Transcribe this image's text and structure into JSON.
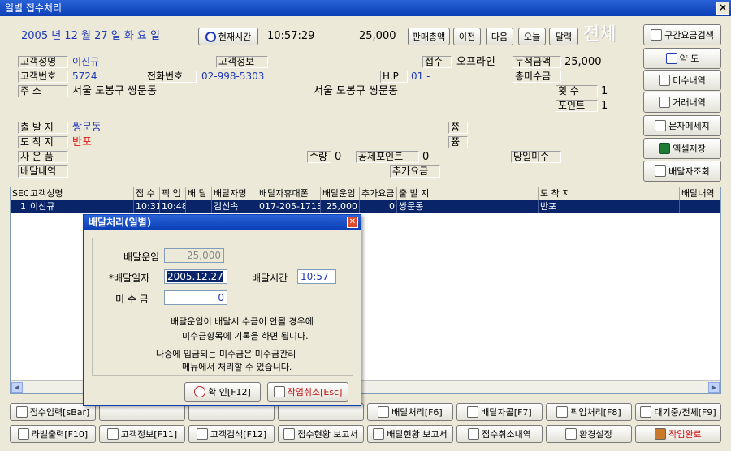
{
  "window": {
    "title": "일별 접수처리",
    "close": "×"
  },
  "header": {
    "date": "2005 년   12 월  27 일  화 요 일",
    "now_button": "현재시간",
    "time": "10:57:29",
    "amount": "25,000",
    "nav": [
      "판매총액",
      "이전",
      "다음",
      "오늘",
      "달력"
    ],
    "all_label": "전체"
  },
  "form": {
    "name_label": "고객성명",
    "name": "이신규",
    "info_label": "고객정보",
    "receipt_label": "접수",
    "receipt": "오프라인",
    "total_label": "누적금액",
    "total": "25,000",
    "custno_label": "고객번호",
    "custno": "5724",
    "phone_label": "전화번호",
    "phone": "02-998-5303",
    "hp_label": "H.P",
    "hp": "01 -",
    "unpaid_label": "총미수금",
    "addr_label": "주      소",
    "addr": "서울 도봉구 쌍문동",
    "addr2": "서울 도봉구 쌍문동",
    "count_label": "횟   수",
    "count": "1",
    "point_label": "포인트",
    "point": "1",
    "origin_label": "출 발 지",
    "origin": "쌍문동",
    "dest_label": "도 착 지",
    "dest": "반포",
    "gift_label": "사 은 품",
    "qty_label": "수량",
    "qty": "0",
    "deduct_label": "공제포인트",
    "deduct": "0",
    "today_unpaid_label": "당일미수",
    "delivery_label": "배달내역",
    "extra_label": "추가요금",
    "mark1": "쯈",
    "mark2": "쯈"
  },
  "side_buttons": [
    "구간요금검색",
    "약 도",
    "미수내역",
    "거래내역",
    "문자메세지",
    "엑셀저장",
    "배달자조회"
  ],
  "grid": {
    "columns": [
      "SEQ",
      "고객성명",
      "접 수",
      "픽 업",
      "배 달",
      "배달자명",
      "배달자휴대폰",
      "배달운임",
      "추가요금",
      "출 발 지",
      "도 착 지",
      "배달내역"
    ],
    "row": [
      "1",
      "이신규",
      "10:31",
      "10:48",
      "",
      "김신속",
      "017-205-1713",
      "25,000",
      "0",
      "쌍문동",
      "반포",
      ""
    ]
  },
  "dialog": {
    "title": "배달처리(일별)",
    "fare_label": "배달운임",
    "fare": "25,000",
    "date_label": "*배달일자",
    "date": "2005.12.27",
    "time_label": "배달시간",
    "time": "10:57",
    "unpaid_label": "미 수 금",
    "unpaid": "0",
    "msg1": "배달운임이 배달시 수금이 안될 경우에",
    "msg2": "미수금항목에 기록을 하면 됩니다.",
    "msg3": "나중에 입금되는 미수금은 미수금관리",
    "msg4": "메뉴에서 처리할 수 있습니다.",
    "ok": "확 인[F12]",
    "cancel": "작업취소[Esc]"
  },
  "bottom_row1": [
    "접수입력[sBar]",
    "",
    "",
    "",
    "배달처리[F6]",
    "배달자콜[F7]",
    "픽업처리[F8]",
    "대기중/전체[F9]"
  ],
  "bottom_row2": [
    "라벨출력[F10]",
    "고객정보[F11]",
    "고객검색[F12]",
    "접수현황 보고서",
    "배달현황 보고서",
    "접수취소내역",
    "환경설정",
    "작업완료"
  ]
}
